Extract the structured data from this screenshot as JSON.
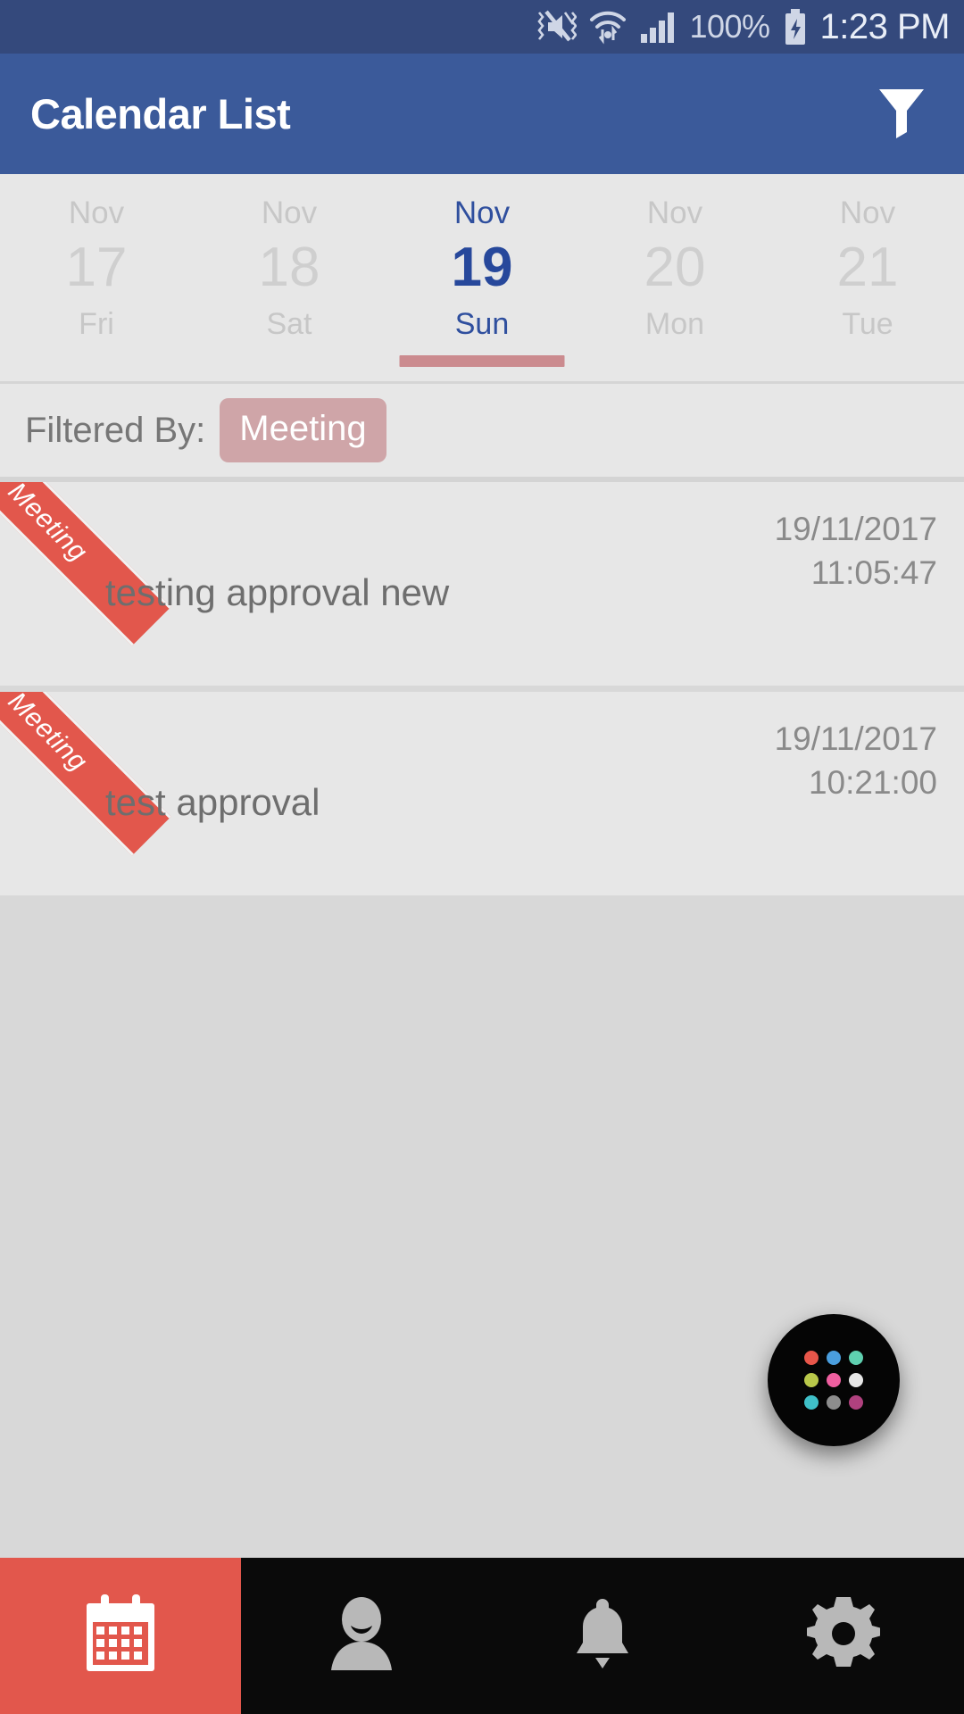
{
  "statusbar": {
    "icons": [
      "mute-icon",
      "wifi-icon",
      "signal-icon"
    ],
    "battery_percent": "100%",
    "battery_icon": "battery-charging-icon",
    "time": "1:23 PM"
  },
  "appbar": {
    "title": "Calendar List",
    "filter_icon": "funnel-filter-icon",
    "bg_color": "#3b5a9a"
  },
  "datestrip": {
    "days": [
      {
        "month": "Nov",
        "date": "17",
        "weekday": "Fri",
        "selected": false
      },
      {
        "month": "Nov",
        "date": "18",
        "weekday": "Sat",
        "selected": false
      },
      {
        "month": "Nov",
        "date": "19",
        "weekday": "Sun",
        "selected": true
      },
      {
        "month": "Nov",
        "date": "20",
        "weekday": "Mon",
        "selected": false
      },
      {
        "month": "Nov",
        "date": "21",
        "weekday": "Tue",
        "selected": false
      }
    ],
    "selected_color": "#27489b",
    "underline_color": "#cb8b8f"
  },
  "filter": {
    "label": "Filtered By:",
    "chip": "Meeting",
    "chip_color": "#cfa5a8"
  },
  "list": {
    "items": [
      {
        "ribbon": "Meeting",
        "title": "testing approval new",
        "date": "19/11/2017",
        "time": "11:05:47"
      },
      {
        "ribbon": "Meeting",
        "title": "test approval",
        "date": "19/11/2017",
        "time": "10:21:00"
      }
    ],
    "ribbon_color": "#e2574c"
  },
  "fab": {
    "icon": "app-grid-dots-icon",
    "bg_color": "#050505",
    "dot_colors": [
      "#e8564a",
      "#4a9ede",
      "#5fd0b0",
      "#b9c84a",
      "#ef5fa0",
      "#e7e7e7",
      "#3fc0c8",
      "#8d8d8d",
      "#b0417e"
    ]
  },
  "bottomnav": {
    "items": [
      {
        "icon": "calendar-icon",
        "active": true
      },
      {
        "icon": "person-icon",
        "active": false
      },
      {
        "icon": "bell-icon",
        "active": false
      },
      {
        "icon": "gear-icon",
        "active": false
      }
    ],
    "active_color": "#e2574c",
    "bg_color": "#0a0a0a"
  }
}
